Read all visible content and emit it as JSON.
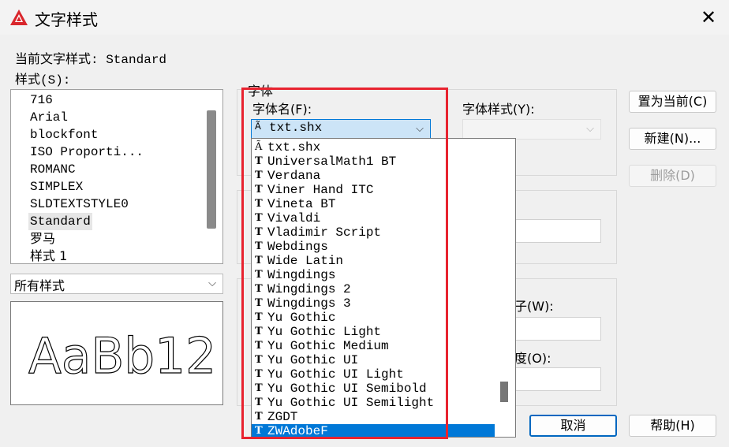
{
  "window": {
    "title": "文字样式",
    "close_icon": "close-icon"
  },
  "current_style_label": "当前文字样式: Standard",
  "styles_label": "样式(S):",
  "styles": [
    "716",
    "Arial",
    "blockfont",
    "ISO Proporti...",
    "ROMANC",
    "SIMPLEX",
    "SLDTEXTSTYLE0",
    "Standard",
    "罗马",
    "样式 1"
  ],
  "selected_style": "Standard",
  "filter_combo": "所有样式",
  "preview_text": "AaBb12",
  "font_group": {
    "title": "字体",
    "font_name_label": "字体名(F):",
    "font_name_value": "txt.shx",
    "font_style_label": "字体样式(Y):"
  },
  "hidden_labels": {
    "width_label": "子(W):",
    "oblique_label": "度(O):"
  },
  "buttons": {
    "set_current": "置为当前(C)",
    "new": "新建(N)...",
    "delete": "删除(D)",
    "cancel": "取消",
    "help": "帮助(H)"
  },
  "font_list": [
    {
      "name": "txt.shx",
      "type": "shx"
    },
    {
      "name": "UniversalMath1 BT",
      "type": "tt"
    },
    {
      "name": "Verdana",
      "type": "tt"
    },
    {
      "name": "Viner Hand ITC",
      "type": "tt"
    },
    {
      "name": "Vineta BT",
      "type": "tt"
    },
    {
      "name": "Vivaldi",
      "type": "tt"
    },
    {
      "name": "Vladimir Script",
      "type": "tt"
    },
    {
      "name": "Webdings",
      "type": "tt"
    },
    {
      "name": "Wide Latin",
      "type": "tt"
    },
    {
      "name": "Wingdings",
      "type": "tt"
    },
    {
      "name": "Wingdings 2",
      "type": "tt"
    },
    {
      "name": "Wingdings 3",
      "type": "tt"
    },
    {
      "name": "Yu Gothic",
      "type": "tt"
    },
    {
      "name": "Yu Gothic Light",
      "type": "tt"
    },
    {
      "name": "Yu Gothic Medium",
      "type": "tt"
    },
    {
      "name": "Yu Gothic UI",
      "type": "tt"
    },
    {
      "name": "Yu Gothic UI Light",
      "type": "tt"
    },
    {
      "name": "Yu Gothic UI Semibold",
      "type": "tt"
    },
    {
      "name": "Yu Gothic UI Semilight",
      "type": "tt"
    },
    {
      "name": "ZGDT",
      "type": "tt"
    },
    {
      "name": "ZWAdobeF",
      "type": "tt"
    }
  ],
  "selected_font": "ZWAdobeF",
  "colors": {
    "accent": "#0078d7",
    "highlight_box": "#e8232f",
    "app_icon": "#d9262c"
  }
}
